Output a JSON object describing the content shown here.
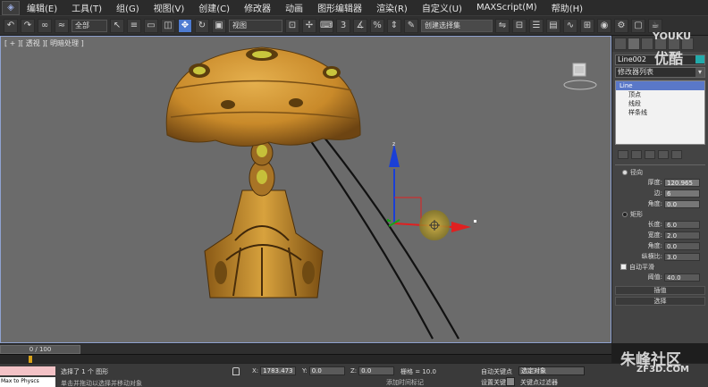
{
  "menubar": {
    "items": [
      "编辑(E)",
      "工具(T)",
      "组(G)",
      "视图(V)",
      "创建(C)",
      "修改器",
      "动画",
      "图形编辑器",
      "渲染(R)",
      "自定义(U)",
      "MAXScript(M)",
      "帮助(H)"
    ]
  },
  "toolbar": {
    "selection_filter": "全部",
    "ref_coord": "视图",
    "selection_set": "创建选择集"
  },
  "viewport": {
    "label": "[ + ][ 透视 ][ 明暗处理 ]"
  },
  "command_panel": {
    "object_name": "Line002",
    "modifier_list": "修改器列表",
    "stack": [
      {
        "label": "Line",
        "selected": true
      },
      {
        "label": "顶点",
        "selected": false
      },
      {
        "label": "线段",
        "selected": false
      },
      {
        "label": "样条线",
        "selected": false
      }
    ],
    "radial": {
      "label": "径向",
      "thickness_label": "厚度:",
      "thickness": "120.965",
      "sides_label": "边:",
      "sides": "6",
      "angle_label": "角度:",
      "angle": "0.0"
    },
    "rect": {
      "label": "矩形",
      "length_label": "长度:",
      "length": "6.0",
      "width_label": "宽度:",
      "width": "2.0",
      "angle_label": "角度:",
      "angle": "0.0",
      "aspect_label": "纵横比:",
      "aspect": "3.0"
    },
    "autosmooth_label": "自动平滑",
    "threshold_label": "阈值:",
    "threshold": "40.0",
    "rollouts": [
      "插值",
      "选择"
    ]
  },
  "timeline": {
    "position": "0 / 100"
  },
  "status": {
    "maxscript": "Max to Physcs",
    "selection": "选择了 1 个 图形",
    "prompt": "单击并拖动以选择并移动对象",
    "x_label": "X:",
    "x": "1783.473",
    "y_label": "Y:",
    "y": "0.0",
    "z_label": "Z:",
    "z": "0.0",
    "grid": "栅格 = 10.0",
    "add_tag": "添加时间标记",
    "auto_key": "自动关键点",
    "set_key": "设置关键点",
    "key_filter_dd": "选定对象",
    "key_filters": "关键点过滤器"
  },
  "watermarks": {
    "youku": "YOUKU",
    "youku_cn": "优酷",
    "zf3d": "朱峰社区",
    "zf3d_url": "ZF3D.COM"
  },
  "colors": {
    "viewport_bg": "#6b6b6b",
    "accent": "#4d7bd1",
    "gizmo_y": "#1a3fd6",
    "gizmo_x": "#e02020",
    "gizmo_z": "#18a018",
    "mushroom": "#c98a2a"
  }
}
